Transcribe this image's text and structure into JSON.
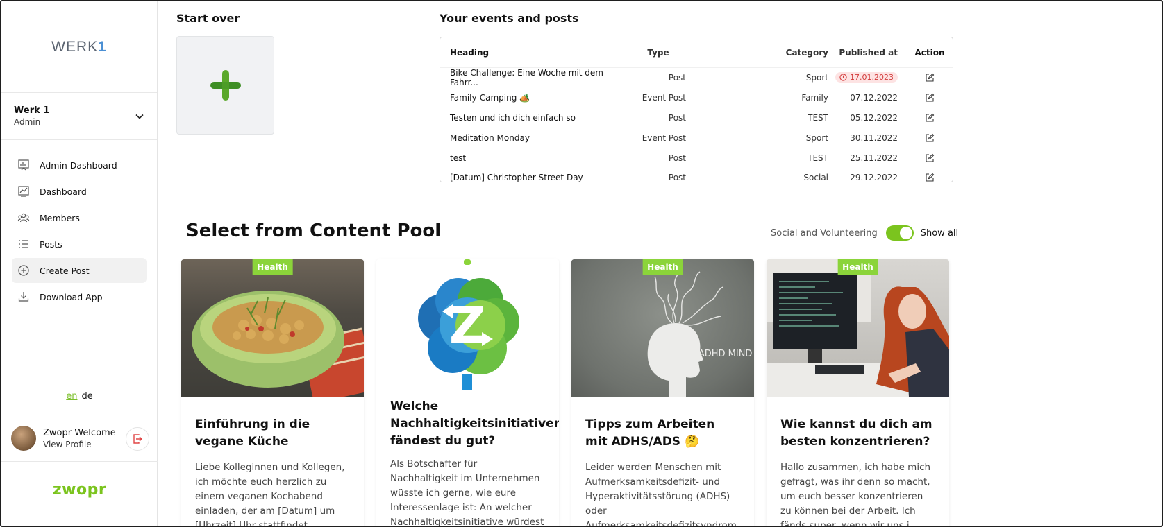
{
  "sidebar": {
    "logo_text": "WERK",
    "logo_number": "1",
    "org": {
      "name": "Werk 1",
      "role": "Admin"
    },
    "nav": [
      {
        "label": "Admin Dashboard",
        "icon": "admin-dashboard-icon"
      },
      {
        "label": "Dashboard",
        "icon": "dashboard-icon"
      },
      {
        "label": "Members",
        "icon": "members-icon"
      },
      {
        "label": "Posts",
        "icon": "posts-icon"
      },
      {
        "label": "Create Post",
        "icon": "create-post-icon",
        "active": true
      },
      {
        "label": "Download App",
        "icon": "download-icon"
      }
    ],
    "languages": {
      "current": "en",
      "other": "de"
    },
    "profile": {
      "name": "Zwopr Welcome",
      "link": "View Profile"
    },
    "brand": "zwopr"
  },
  "start_over": {
    "title": "Start over"
  },
  "events": {
    "title": "Your events and posts",
    "columns": [
      "Heading",
      "Type",
      "Category",
      "Published at",
      "Action"
    ],
    "rows": [
      {
        "heading": "Bike Challenge: Eine Woche mit dem Fahrr...",
        "type": "Post",
        "category": "Sport",
        "published": "17.01.2023",
        "scheduled": true
      },
      {
        "heading": "Family-Camping 🏕️",
        "type": "Event Post",
        "category": "Family",
        "published": "07.12.2022"
      },
      {
        "heading": "Testen und ich dich einfach so",
        "type": "Post",
        "category": "TEST",
        "published": "05.12.2022"
      },
      {
        "heading": "Meditation Monday",
        "type": "Event Post",
        "category": "Sport",
        "published": "30.11.2022"
      },
      {
        "heading": "test",
        "type": "Post",
        "category": "TEST",
        "published": "25.11.2022"
      },
      {
        "heading": "[Datum] Christopher Street Day",
        "type": "Post",
        "category": "Social",
        "published": "29.12.2022"
      }
    ]
  },
  "pool": {
    "title": "Select from Content Pool",
    "filter_label": "Social and Volunteering",
    "toggle_on": true,
    "show_all": "Show all",
    "cards": [
      {
        "tag": "Health",
        "title": "Einführung in die vegane Küche",
        "text": "Liebe Kolleginnen und Kollegen, ich möchte euch herzlich zu einem veganen Kochabend einladen, der am [Datum] um [Uhrzeit] Uhr stattfindet. Gemeinsam ..."
      },
      {
        "tag": "",
        "title": "Welche Nachhaltigkeitsinitiativen fändest du gut?",
        "text": "Als Botschafter für Nachhaltigkeit im Unternehmen wüsste ich gerne, wie eure Interessenlage ist: An welcher Nachhaltigkeitsinitiative würdest du dich ..."
      },
      {
        "tag": "Health",
        "title": "Tipps zum Arbeiten mit ADHS/ADS 🤔",
        "text": "Leider werden Menschen mit Aufmerksamkeitsdefizit- und Hyperaktivitätsstörung (ADHS) oder Aufmerksamkeitsdefizitsyndrom"
      },
      {
        "tag": "Health",
        "title": "Wie kannst du dich am besten konzentrieren?",
        "text": "Hallo zusammen, ich habe mich gefragt, was ihr denn so macht, um euch besser konzentrieren zu können bei der Arbeit. Ich fänds super, wenn wir uns i..."
      }
    ],
    "image_texts": {
      "adhd": "MY ADHD MIND",
      "z_logo": "Z"
    }
  },
  "colors": {
    "accent": "#7bc41e",
    "badge_red": "#d23b3b",
    "tile_bg": "#f1f2f4"
  }
}
